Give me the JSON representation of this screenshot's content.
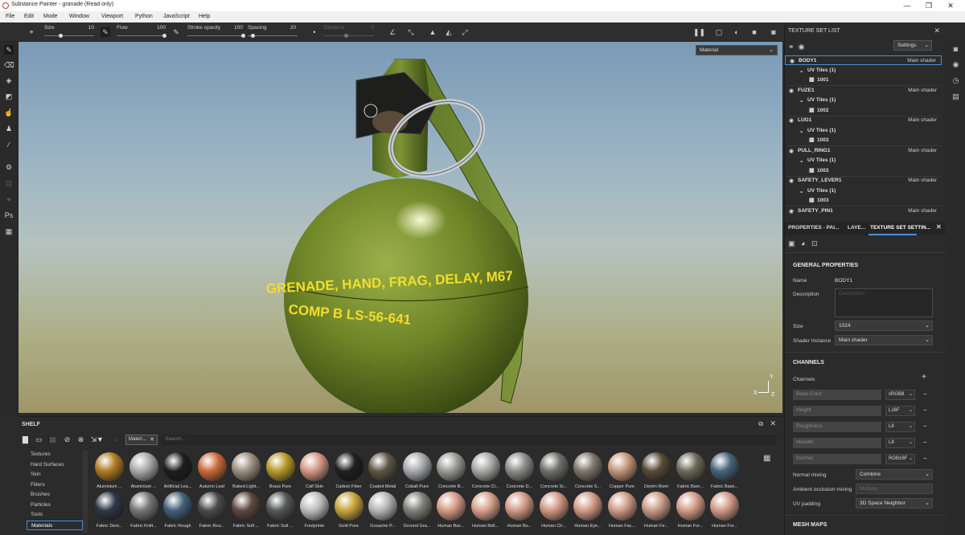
{
  "window": {
    "title": "Substance Painter - granade (Read only)",
    "min": "—",
    "max": "❐",
    "close": "✕"
  },
  "menu": [
    "File",
    "Edit",
    "Mode",
    "Window",
    "Viewport",
    "Python",
    "JavaScript",
    "Help"
  ],
  "toolbar": {
    "size_label": "Size",
    "size_value": "10",
    "flow_label": "Flow",
    "flow_value": "100",
    "stroke_label": "Stroke opacity",
    "stroke_value": "100",
    "spacing_label": "Spacing",
    "spacing_value": "20",
    "distance_label": "Distance",
    "distance_value": "5"
  },
  "viewport": {
    "mode": "Material",
    "axis_y": "Y",
    "axis_x": "X",
    "axis_z": "Z"
  },
  "grenade_text": {
    "line1": "GRENADE, HAND, FRAG, DELAY, M67",
    "line2": "COMP B LS-56-641"
  },
  "shelf": {
    "title": "SHELF",
    "filter_chip": "Materi...",
    "search_placeholder": "Search...",
    "categories": [
      "Textures",
      "Hard Surfaces",
      "Skin",
      "Filters",
      "Brushes",
      "Particles",
      "Tools",
      "Materials"
    ],
    "selected_category": "Materials",
    "materials_row1": [
      {
        "name": "Aluminium ...",
        "color": "#b07b22"
      },
      {
        "name": "Aluminium ...",
        "color": "#a9a9a9"
      },
      {
        "name": "Artificial Lea...",
        "color": "#1e1e1e"
      },
      {
        "name": "Autumn Leaf",
        "color": "#c96a3a"
      },
      {
        "name": "Baked Light...",
        "color": "#9b8f80"
      },
      {
        "name": "Brass Pure",
        "color": "#b8982b"
      },
      {
        "name": "Calf Skin",
        "color": "#d29784"
      },
      {
        "name": "Carbon Fiber",
        "color": "#1f1f1f"
      },
      {
        "name": "Coated Metal",
        "color": "#5e5746"
      },
      {
        "name": "Cobalt Pure",
        "color": "#a7a9ad"
      },
      {
        "name": "Concrete B...",
        "color": "#9a9a96"
      },
      {
        "name": "Concrete Cl...",
        "color": "#a7a7a5"
      },
      {
        "name": "Concrete D...",
        "color": "#8c8c89"
      },
      {
        "name": "Concrete Si...",
        "color": "#6f6f6d"
      },
      {
        "name": "Concrete S...",
        "color": "#7d776c"
      },
      {
        "name": "Copper Pure",
        "color": "#c49679"
      },
      {
        "name": "Denim Rivet",
        "color": "#5a4a37"
      },
      {
        "name": "Fabric Bam...",
        "color": "#6c6a58"
      },
      {
        "name": "Fabric Base...",
        "color": "#476478"
      }
    ],
    "materials_row2": [
      {
        "name": "Fabric Deni...",
        "color": "#2f3846"
      },
      {
        "name": "Fabric Knitt...",
        "color": "#767676"
      },
      {
        "name": "Fabric Rough",
        "color": "#43607a"
      },
      {
        "name": "Fabric Rou...",
        "color": "#4a4a4a"
      },
      {
        "name": "Fabric Soft ...",
        "color": "#5c4a40"
      },
      {
        "name": "Fabric Suit ...",
        "color": "#555858"
      },
      {
        "name": "Footprints",
        "color": "#bdbdbd"
      },
      {
        "name": "Gold Pure",
        "color": "#c7a43a"
      },
      {
        "name": "Gouache P...",
        "color": "#b5b5b5"
      },
      {
        "name": "Ground Gra...",
        "color": "#7f8078"
      },
      {
        "name": "Human Bac...",
        "color": "#d59a86"
      },
      {
        "name": "Human Bell...",
        "color": "#d6a08b"
      },
      {
        "name": "Human Bu...",
        "color": "#d29a86"
      },
      {
        "name": "Human Ch...",
        "color": "#d19883"
      },
      {
        "name": "Human Eye...",
        "color": "#d29b88"
      },
      {
        "name": "Human Fac...",
        "color": "#cf9a87"
      },
      {
        "name": "Human Fe...",
        "color": "#c99b84"
      },
      {
        "name": "Human For...",
        "color": "#d39b87"
      },
      {
        "name": "Human For...",
        "color": "#d09a86"
      }
    ]
  },
  "texture_set_list": {
    "title": "TEXTURE SET LIST",
    "settings": "Settings",
    "sets": [
      {
        "name": "BODY1",
        "shader": "Main shader",
        "uv": "UV Tiles (1)",
        "tile": "1001"
      },
      {
        "name": "FUZE1",
        "shader": "Main shader",
        "uv": "UV Tiles (1)",
        "tile": "1002"
      },
      {
        "name": "LUG1",
        "shader": "Main shader",
        "uv": "UV Tiles (1)",
        "tile": "1003"
      },
      {
        "name": "PULL_RING1",
        "shader": "Main shader",
        "uv": "UV Tiles (1)",
        "tile": "1003"
      },
      {
        "name": "SAFETY_LEVER1",
        "shader": "Main shader",
        "uv": "UV Tiles (1)",
        "tile": "1003"
      },
      {
        "name": "SAFETY_PIN1",
        "shader": "Main shader"
      }
    ]
  },
  "properties": {
    "tabs": [
      "PROPERTIES - PAI...",
      "LAYE...",
      "TEXTURE SET SETTIN..."
    ],
    "general_title": "GENERAL PROPERTIES",
    "name_label": "Name",
    "name_value": "BODY1",
    "description_label": "Description",
    "description_placeholder": "Description",
    "size_label": "Size",
    "size_value": "1024",
    "shader_label": "Shader Instance",
    "shader_value": "Main shader",
    "channels_title": "CHANNELS",
    "channels_label": "Channels",
    "channels": [
      {
        "name": "Base Color",
        "format": "sRGB8"
      },
      {
        "name": "Height",
        "format": "L16F"
      },
      {
        "name": "Roughness",
        "format": "L8"
      },
      {
        "name": "Metallic",
        "format": "L8"
      },
      {
        "name": "Normal",
        "format": "RGB16F"
      }
    ],
    "normal_mixing_label": "Normal mixing",
    "normal_mixing_value": "Combine",
    "ao_mixing_label": "Ambient occlusion mixing",
    "ao_mixing_value": "Multiply",
    "uv_padding_label": "UV padding",
    "uv_padding_value": "3D Space Neighbor",
    "mesh_maps_title": "MESH MAPS"
  }
}
